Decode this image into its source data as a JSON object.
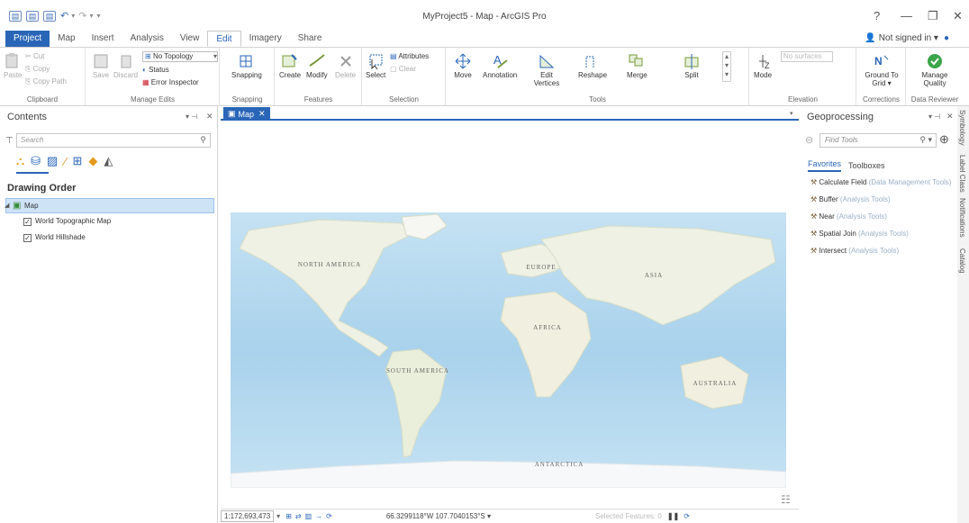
{
  "window": {
    "title": "MyProject5 - Map - ArcGIS Pro",
    "help": "?",
    "minimize": "—",
    "restore": "❐",
    "close": "✕"
  },
  "tabs": [
    {
      "label": "Project"
    },
    {
      "label": "Map"
    },
    {
      "label": "Insert"
    },
    {
      "label": "Analysis"
    },
    {
      "label": "View"
    },
    {
      "label": "Edit"
    },
    {
      "label": "Imagery"
    },
    {
      "label": "Share"
    }
  ],
  "account": {
    "label": "Not signed in ▾"
  },
  "ribbon": {
    "clipboard": {
      "cut": "Cut",
      "copy": "Copy",
      "paste": "Paste",
      "copy_path": "Copy Path",
      "label": "Clipboard"
    },
    "manage_edits": {
      "save": "Save",
      "discard": "Discard",
      "topology": "No Topology",
      "status": "Status",
      "error_inspector": "Error Inspector",
      "label": "Manage Edits"
    },
    "snapping": {
      "button": "Snapping",
      "label": "Snapping"
    },
    "features": {
      "create": "Create",
      "modify": "Modify",
      "delete": "Delete",
      "label": "Features"
    },
    "selection": {
      "select": "Select",
      "attributes": "Attributes",
      "clear": "Clear",
      "label": "Selection"
    },
    "tools": {
      "move": "Move",
      "annotation": "Annotation",
      "edit_vertices": "Edit Vertices",
      "reshape": "Reshape",
      "merge": "Merge",
      "split": "Split",
      "label": "Tools"
    },
    "elevation": {
      "mode": "Mode",
      "surfaces": "No surfaces",
      "label": "Elevation"
    },
    "corrections": {
      "ground": "Ground To Grid ▾",
      "label": "Corrections"
    },
    "reviewer": {
      "manage": "Manage Quality",
      "label": "Data Reviewer"
    }
  },
  "contents": {
    "title": "Contents",
    "search_placeholder": "Search",
    "drawing_order": "Drawing Order",
    "map_item": "Map",
    "layers": [
      {
        "name": "World Topographic Map"
      },
      {
        "name": "World Hillshade"
      }
    ]
  },
  "map_tab": {
    "label": "Map"
  },
  "map_labels": {
    "north_america": "NORTH AMERICA",
    "south_america": "SOUTH AMERICA",
    "europe": "EUROPE",
    "asia": "ASIA",
    "africa": "AFRICA",
    "australia": "AUSTRALIA",
    "antarctica": "ANTARCTICA"
  },
  "statusbar": {
    "scale": "1:172,693,473",
    "coords": "66.3299118°W 107.7040153°S ▾",
    "selected": "Selected Features: 0"
  },
  "geoprocessing": {
    "title": "Geoprocessing",
    "find_placeholder": "Find Tools",
    "favorites": "Favorites",
    "toolboxes": "Toolboxes",
    "tools": [
      {
        "name": "Calculate Field",
        "box": "(Data Management Tools)"
      },
      {
        "name": "Buffer",
        "box": "(Analysis Tools)"
      },
      {
        "name": "Near",
        "box": "(Analysis Tools)"
      },
      {
        "name": "Spatial Join",
        "box": "(Analysis Tools)"
      },
      {
        "name": "Intersect",
        "box": "(Analysis Tools)"
      }
    ]
  },
  "side_tabs": [
    {
      "label": "Symbology"
    },
    {
      "label": "Label Class"
    },
    {
      "label": "Notifications"
    },
    {
      "label": "Catalog"
    }
  ],
  "colors": {
    "accent": "#2a66b8",
    "ocean": "#a9d2ec",
    "land": "#eef1e3"
  }
}
